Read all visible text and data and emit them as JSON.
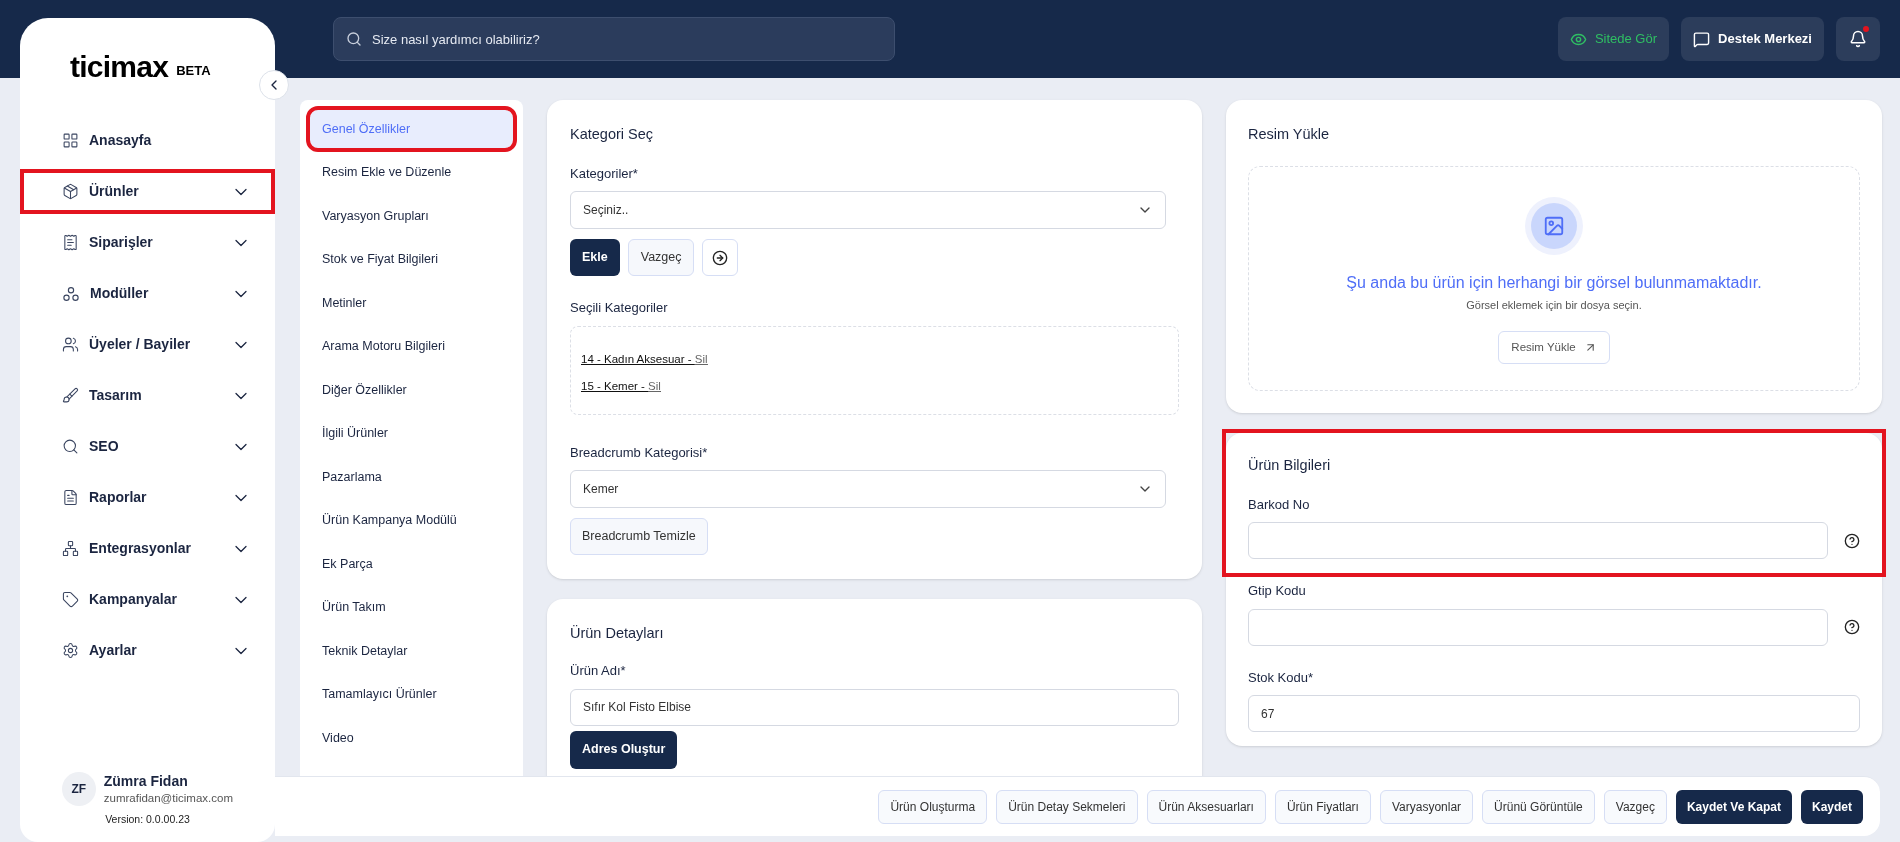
{
  "sidebar": {
    "logo": "ticimax",
    "badge": "BETA",
    "items": [
      {
        "label": "Anasayfa",
        "expandable": false,
        "highlighted": false
      },
      {
        "label": "Ürünler",
        "expandable": true,
        "highlighted": true
      },
      {
        "label": "Siparişler",
        "expandable": true,
        "highlighted": false
      },
      {
        "label": "Modüller",
        "expandable": true,
        "highlighted": false
      },
      {
        "label": "Üyeler / Bayiler",
        "expandable": true,
        "highlighted": false
      },
      {
        "label": "Tasarım",
        "expandable": true,
        "highlighted": false
      },
      {
        "label": "SEO",
        "expandable": true,
        "highlighted": false
      },
      {
        "label": "Raporlar",
        "expandable": true,
        "highlighted": false
      },
      {
        "label": "Entegrasyonlar",
        "expandable": true,
        "highlighted": false
      },
      {
        "label": "Kampanyalar",
        "expandable": true,
        "highlighted": false
      },
      {
        "label": "Ayarlar",
        "expandable": true,
        "highlighted": false
      }
    ],
    "user": {
      "initials": "ZF",
      "name": "Zümra Fidan",
      "email": "zumrafidan@ticimax.com",
      "version": "Version: 0.0.00.23"
    }
  },
  "topbar": {
    "search": {
      "placeholder": "Size nasıl yardımcı olabiliriz?"
    },
    "view_site": "Sitede Gör",
    "support": "Destek Merkezi",
    "has_notification": true
  },
  "tabs": [
    {
      "label": "Genel Özellikler",
      "selected": true,
      "highlighted": true
    },
    {
      "label": "Resim Ekle ve Düzenle",
      "selected": false,
      "highlighted": false
    },
    {
      "label": "Varyasyon Grupları",
      "selected": false,
      "highlighted": false
    },
    {
      "label": "Stok ve Fiyat Bilgileri",
      "selected": false,
      "highlighted": false
    },
    {
      "label": "Metinler",
      "selected": false,
      "highlighted": false
    },
    {
      "label": "Arama Motoru Bilgileri",
      "selected": false,
      "highlighted": false
    },
    {
      "label": "Diğer Özellikler",
      "selected": false,
      "highlighted": false
    },
    {
      "label": "İlgili Ürünler",
      "selected": false,
      "highlighted": false
    },
    {
      "label": "Pazarlama",
      "selected": false,
      "highlighted": false
    },
    {
      "label": "Ürün Kampanya Modülü",
      "selected": false,
      "highlighted": false
    },
    {
      "label": "Ek Parça",
      "selected": false,
      "highlighted": false
    },
    {
      "label": "Ürün Takım",
      "selected": false,
      "highlighted": false
    },
    {
      "label": "Teknik Detaylar",
      "selected": false,
      "highlighted": false
    },
    {
      "label": "Tamamlayıcı Ürünler",
      "selected": false,
      "highlighted": false
    },
    {
      "label": "Video",
      "selected": false,
      "highlighted": false
    }
  ],
  "category_card": {
    "title": "Kategori Seç",
    "categories_label": "Kategoriler*",
    "categories_value": "Seçiniz..",
    "add": "Ekle",
    "cancel": "Vazgeç",
    "selected_label": "Seçili Kategoriler",
    "selected": [
      {
        "text": "14 - Kadın Aksesuar - ",
        "remove": "Sil"
      },
      {
        "text": "15 - Kemer - ",
        "remove": "Sil"
      }
    ],
    "breadcrumb_label": "Breadcrumb Kategorisi*",
    "breadcrumb_value": "Kemer",
    "breadcrumb_clear": "Breadcrumb Temizle"
  },
  "details_card": {
    "title": "Ürün Detayları",
    "name_label": "Ürün Adı*",
    "name_value": "Sıfır Kol Fisto Elbise",
    "make_address": "Adres Oluştur"
  },
  "image_card": {
    "title": "Resim Yükle",
    "empty_title": "Şu anda bu ürün için herhangi bir görsel bulunmamaktadır.",
    "empty_hint": "Görsel eklemek için bir dosya seçin.",
    "upload": "Resim Yükle"
  },
  "product_info": {
    "title": "Ürün Bilgileri",
    "highlighted": true,
    "barcode_label": "Barkod No",
    "gtip_label": "Gtip Kodu",
    "stock_label": "Stok Kodu*",
    "stock_value": "67"
  },
  "footer_buttons": [
    {
      "label": "Ürün Oluşturma",
      "kind": "outline"
    },
    {
      "label": "Ürün Detay Sekmeleri",
      "kind": "outline"
    },
    {
      "label": "Ürün Aksesuarları",
      "kind": "outline"
    },
    {
      "label": "Ürün Fiyatları",
      "kind": "outline"
    },
    {
      "label": "Varyasyonlar",
      "kind": "outline"
    },
    {
      "label": "Ürünü Görüntüle",
      "kind": "outline"
    },
    {
      "label": "Vazgeç",
      "kind": "outline"
    },
    {
      "label": "Kaydet Ve Kapat",
      "kind": "primary"
    },
    {
      "label": "Kaydet",
      "kind": "primary"
    }
  ]
}
